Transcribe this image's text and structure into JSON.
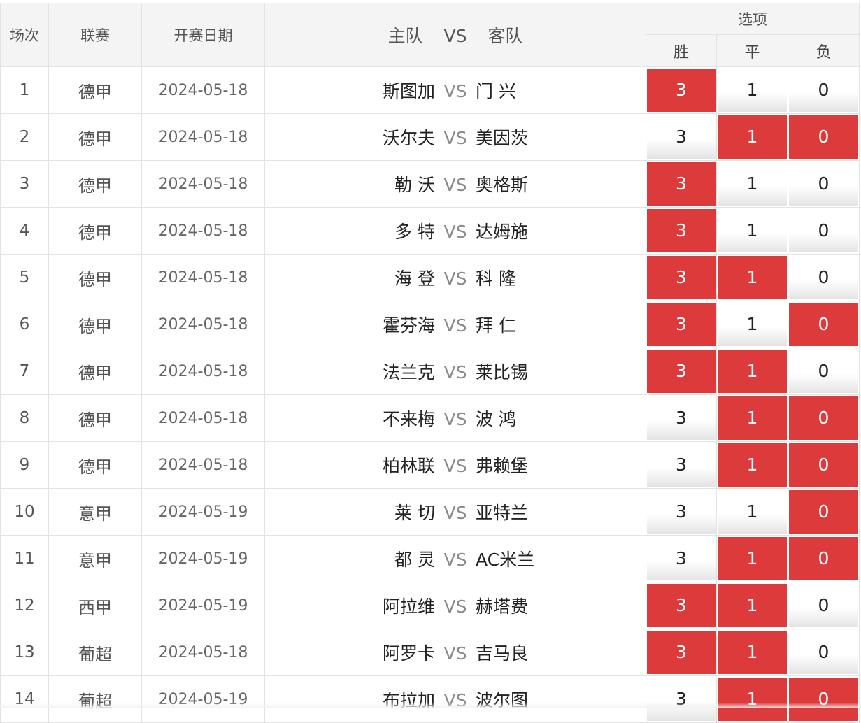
{
  "header": {
    "idx": "场次",
    "league": "联赛",
    "date": "开赛日期",
    "home": "主队",
    "vs": "VS",
    "away": "客队",
    "options": "选项",
    "win": "胜",
    "draw": "平",
    "lose": "负"
  },
  "colors": {
    "selected": "#dd3a3c",
    "header_bg": "#f4f4f4"
  },
  "rows": [
    {
      "idx": "1",
      "league": "德甲",
      "date": "2024-05-18",
      "home": "斯图加",
      "away": "门 兴",
      "w": "3",
      "d": "1",
      "l": "0",
      "sel": [
        true,
        false,
        false
      ]
    },
    {
      "idx": "2",
      "league": "德甲",
      "date": "2024-05-18",
      "home": "沃尔夫",
      "away": "美因茨",
      "w": "3",
      "d": "1",
      "l": "0",
      "sel": [
        false,
        true,
        true
      ]
    },
    {
      "idx": "3",
      "league": "德甲",
      "date": "2024-05-18",
      "home": "勒 沃",
      "away": "奥格斯",
      "w": "3",
      "d": "1",
      "l": "0",
      "sel": [
        true,
        false,
        false
      ]
    },
    {
      "idx": "4",
      "league": "德甲",
      "date": "2024-05-18",
      "home": "多 特",
      "away": "达姆施",
      "w": "3",
      "d": "1",
      "l": "0",
      "sel": [
        true,
        false,
        false
      ]
    },
    {
      "idx": "5",
      "league": "德甲",
      "date": "2024-05-18",
      "home": "海 登",
      "away": "科 隆",
      "w": "3",
      "d": "1",
      "l": "0",
      "sel": [
        true,
        true,
        false
      ]
    },
    {
      "idx": "6",
      "league": "德甲",
      "date": "2024-05-18",
      "home": "霍芬海",
      "away": "拜 仁",
      "w": "3",
      "d": "1",
      "l": "0",
      "sel": [
        true,
        false,
        true
      ]
    },
    {
      "idx": "7",
      "league": "德甲",
      "date": "2024-05-18",
      "home": "法兰克",
      "away": "莱比锡",
      "w": "3",
      "d": "1",
      "l": "0",
      "sel": [
        true,
        true,
        false
      ]
    },
    {
      "idx": "8",
      "league": "德甲",
      "date": "2024-05-18",
      "home": "不来梅",
      "away": "波 鸿",
      "w": "3",
      "d": "1",
      "l": "0",
      "sel": [
        false,
        true,
        true
      ]
    },
    {
      "idx": "9",
      "league": "德甲",
      "date": "2024-05-18",
      "home": "柏林联",
      "away": "弗赖堡",
      "w": "3",
      "d": "1",
      "l": "0",
      "sel": [
        false,
        true,
        true
      ]
    },
    {
      "idx": "10",
      "league": "意甲",
      "date": "2024-05-19",
      "home": "莱 切",
      "away": "亚特兰",
      "w": "3",
      "d": "1",
      "l": "0",
      "sel": [
        false,
        false,
        true
      ]
    },
    {
      "idx": "11",
      "league": "意甲",
      "date": "2024-05-19",
      "home": "都 灵",
      "away": "AC米兰",
      "w": "3",
      "d": "1",
      "l": "0",
      "sel": [
        false,
        true,
        true
      ]
    },
    {
      "idx": "12",
      "league": "西甲",
      "date": "2024-05-19",
      "home": "阿拉维",
      "away": "赫塔费",
      "w": "3",
      "d": "1",
      "l": "0",
      "sel": [
        true,
        true,
        false
      ]
    },
    {
      "idx": "13",
      "league": "葡超",
      "date": "2024-05-18",
      "home": "阿罗卡",
      "away": "吉马良",
      "w": "3",
      "d": "1",
      "l": "0",
      "sel": [
        true,
        true,
        false
      ]
    },
    {
      "idx": "14",
      "league": "葡超",
      "date": "2024-05-19",
      "home": "布拉加",
      "away": "波尔图",
      "w": "3",
      "d": "1",
      "l": "0",
      "sel": [
        false,
        true,
        true
      ]
    }
  ]
}
